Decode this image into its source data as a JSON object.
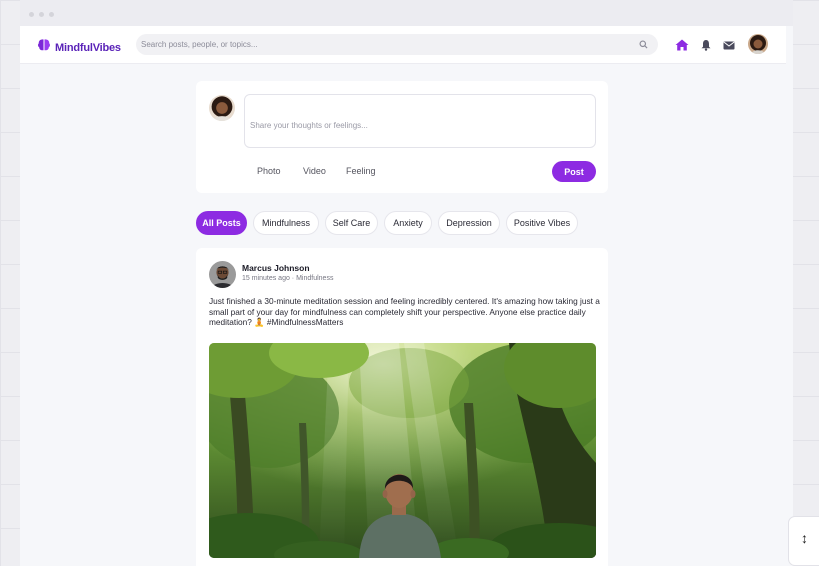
{
  "app": {
    "name": "MindfulVibes",
    "brand_color": "#8d2be2",
    "logo_icon": "brain-icon"
  },
  "search": {
    "placeholder": "Search posts, people, or topics..."
  },
  "nav": {
    "icons": [
      "home-icon",
      "bell-icon",
      "mail-icon"
    ],
    "active": "home"
  },
  "composer": {
    "placeholder": "Share your thoughts or feelings...",
    "actions": [
      "Photo",
      "Video",
      "Feeling"
    ],
    "submit_label": "Post"
  },
  "filters": {
    "items": [
      "All Posts",
      "Mindfulness",
      "Self Care",
      "Anxiety",
      "Depression",
      "Positive Vibes"
    ],
    "active_index": 0
  },
  "post": {
    "author": "Marcus Johnson",
    "meta": "15 minutes ago · Mindfulness",
    "content": "Just finished a 30-minute meditation session and feeling incredibly centered. It's amazing how taking just a small part of your day for mindfulness can completely shift your perspective. Anyone else practice daily meditation? 🧘 #MindfulnessMatters",
    "image_desc": "forest-meditation-image"
  }
}
